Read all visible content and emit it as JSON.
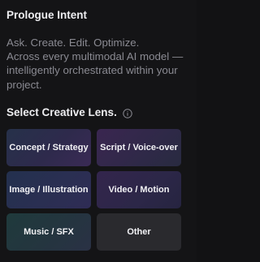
{
  "header": {
    "title": "Prologue Intent"
  },
  "tagline": {
    "line1": "Ask. Create. Edit. Optimize.",
    "line2": "Across every multimodal AI model —",
    "line3": "intelligently orchestrated within your",
    "line4": "project."
  },
  "lens": {
    "heading": "Select Creative Lens.",
    "info_icon": "info-circle-icon",
    "options": [
      {
        "label": "Concept / Strategy"
      },
      {
        "label": "Script / Voice-over"
      },
      {
        "label": "Image / Illustration"
      },
      {
        "label": "Video / Motion"
      },
      {
        "label": "Music / SFX"
      },
      {
        "label": "Other"
      }
    ]
  },
  "colors": {
    "background": "#141416",
    "title_text": "#ededf0",
    "muted_text": "#8a8a92",
    "button_text": "#f2f2f5",
    "other_button": "#2a2a2e"
  }
}
